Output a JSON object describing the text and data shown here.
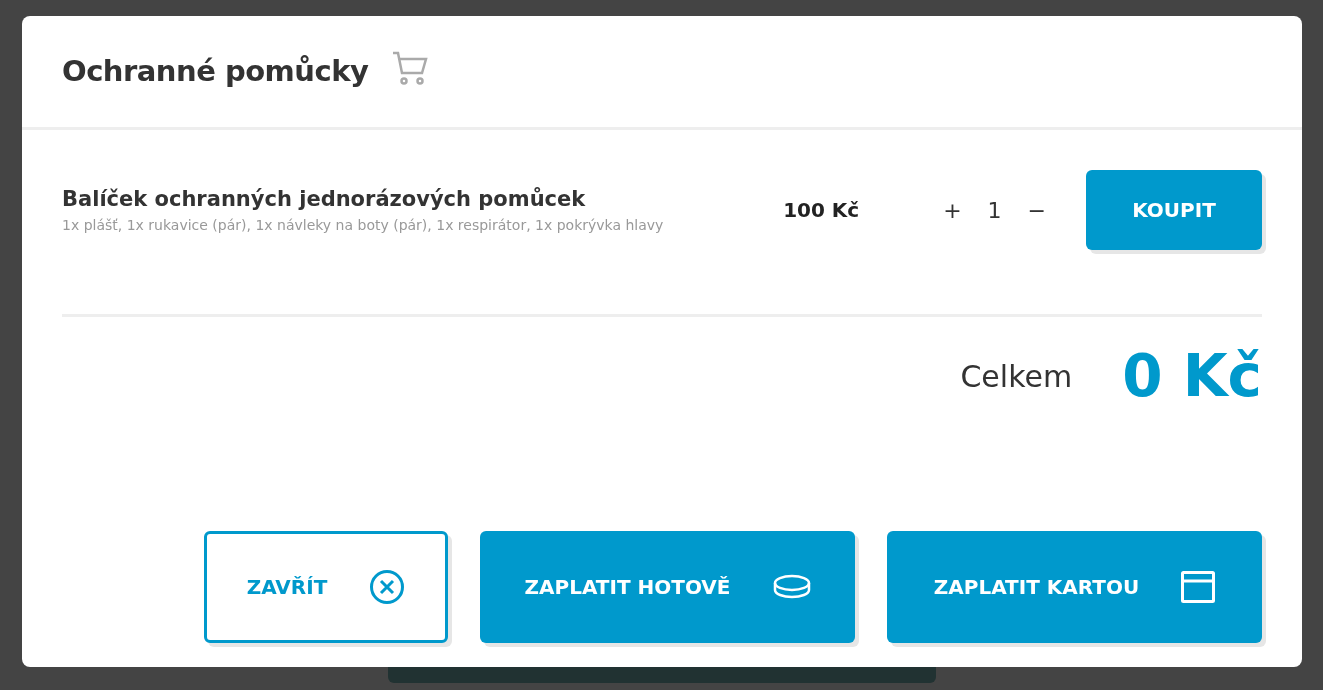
{
  "dialog": {
    "title": "Ochranné pomůcky"
  },
  "items": [
    {
      "name": "Balíček ochranných jednorázových pomůcek",
      "description": "1x plášť, 1x rukavice (pár), 1x návleky na boty (pár), 1x respirátor, 1x pokrývka hlavy",
      "price": "100 Kč",
      "increase": "+",
      "quantity": "1",
      "decrease": "−",
      "buy": "KOUPIT"
    }
  ],
  "total": {
    "label": "Celkem",
    "value": "0 Kč"
  },
  "buttons": [
    {
      "label": "ZAVŘÍT",
      "kind": "outline"
    },
    {
      "label": "ZAPLATIT HOTOVĚ",
      "kind": "primary"
    },
    {
      "label": "ZAPLATIT KARTOU",
      "kind": "primary"
    }
  ]
}
